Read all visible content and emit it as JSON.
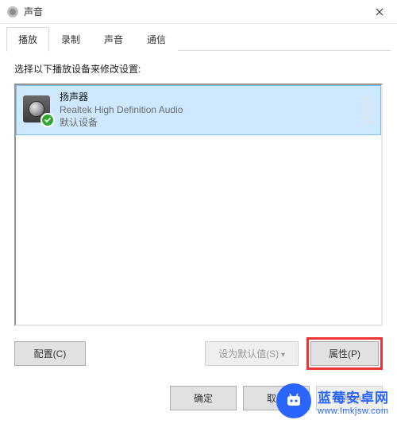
{
  "window": {
    "title": "声音"
  },
  "tabs": [
    {
      "label": "播放",
      "active": true
    },
    {
      "label": "录制",
      "active": false
    },
    {
      "label": "声音",
      "active": false
    },
    {
      "label": "通信",
      "active": false
    }
  ],
  "panel": {
    "instruction": "选择以下播放设备来修改设置:",
    "devices": [
      {
        "name": "扬声器",
        "sub": "Realtek High Definition Audio",
        "status": "默认设备",
        "selected": true,
        "default": true
      }
    ]
  },
  "buttons": {
    "configure": "配置(C)",
    "set_default": "设为默认值(S)",
    "properties": "属性(P)",
    "ok": "确定",
    "cancel": "取消",
    "apply": "应用(A)"
  },
  "watermark": {
    "line1": "蓝莓安卓网",
    "line2": "www.lmkjsw.com"
  }
}
